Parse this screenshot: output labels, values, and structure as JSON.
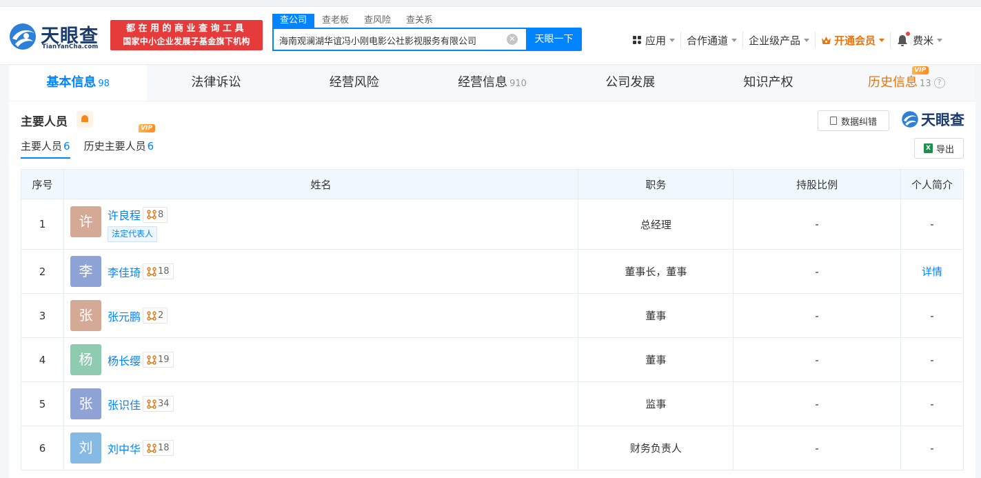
{
  "header": {
    "logo_text": "天眼查",
    "logo_sub": "TianYanCha.com",
    "slogan_line1": "都在用的商业查询工具",
    "slogan_line2": "国家中小企业发展子基金旗下机构",
    "search_tabs": [
      "查公司",
      "查老板",
      "查风险",
      "查关系"
    ],
    "search_value": "海南观澜湖华谊冯小刚电影公社影视服务有限公司",
    "search_button": "天眼一下",
    "nav": {
      "apps": "应用",
      "partners": "合作通道",
      "enterprise": "企业级产品",
      "vip": "开通会员",
      "user": "费米"
    }
  },
  "tabs": [
    {
      "label": "基本信息",
      "count": "98"
    },
    {
      "label": "法律诉讼",
      "count": ""
    },
    {
      "label": "经营风险",
      "count": ""
    },
    {
      "label": "经营信息",
      "count": "910"
    },
    {
      "label": "公司发展",
      "count": ""
    },
    {
      "label": "知识产权",
      "count": ""
    },
    {
      "label": "历史信息",
      "count": "13",
      "vip": "VIP"
    }
  ],
  "section": {
    "title": "主要人员",
    "correct_button": "数据纠错",
    "brand": "天眼查",
    "subtab_current": "主要人员",
    "subtab_current_count": "6",
    "subtab_history": "历史主要人员",
    "subtab_history_count": "6",
    "subtab_history_badge": "VIP",
    "export_button": "导出",
    "xls_icon_text": "X"
  },
  "table": {
    "headers": [
      "序号",
      "姓名",
      "职务",
      "持股比例",
      "个人简介"
    ],
    "rows": [
      {
        "idx": "1",
        "avatar": "许",
        "avatar_color": "#d4aa96",
        "name": "许良程",
        "rel": "8",
        "tag": "法定代表人",
        "role": "总经理",
        "share": "-",
        "bio": "-"
      },
      {
        "idx": "2",
        "avatar": "李",
        "avatar_color": "#8fa3d6",
        "name": "李佳琦",
        "rel": "18",
        "tag": "",
        "role": "董事长，董事",
        "share": "-",
        "bio": "详情"
      },
      {
        "idx": "3",
        "avatar": "张",
        "avatar_color": "#d4aa96",
        "name": "张元鹏",
        "rel": "2",
        "tag": "",
        "role": "董事",
        "share": "-",
        "bio": "-"
      },
      {
        "idx": "4",
        "avatar": "杨",
        "avatar_color": "#8ecbb0",
        "name": "杨长缨",
        "rel": "19",
        "tag": "",
        "role": "董事",
        "share": "-",
        "bio": "-"
      },
      {
        "idx": "5",
        "avatar": "张",
        "avatar_color": "#8fa3d6",
        "name": "张识佳",
        "rel": "34",
        "tag": "",
        "role": "监事",
        "share": "-",
        "bio": "-"
      },
      {
        "idx": "6",
        "avatar": "刘",
        "avatar_color": "#86b9e3",
        "name": "刘中华",
        "rel": "18",
        "tag": "",
        "role": "财务负责人",
        "share": "-",
        "bio": "-"
      }
    ]
  }
}
